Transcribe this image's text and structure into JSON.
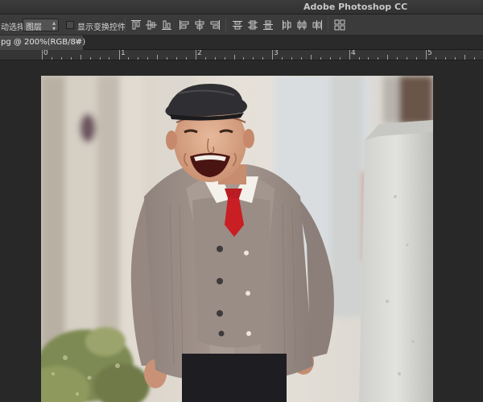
{
  "app": {
    "title": "Adobe Photoshop CC"
  },
  "options_bar": {
    "auto_select_label": "动选择:",
    "auto_select_value": "图层",
    "show_transform_label": "显示变换控件"
  },
  "document_tab": {
    "label": "pg @ 200%(RGB/8#)",
    "close": "×"
  },
  "ruler": {
    "labels": [
      "0",
      "1",
      "2",
      "3",
      "4",
      "5"
    ]
  },
  "icons": {
    "align": [
      "align-top-icon",
      "align-vcenter-icon",
      "align-bottom-icon",
      "align-left-icon",
      "align-hcenter-icon",
      "align-right-icon",
      "distribute-top-icon",
      "distribute-vcenter-icon",
      "distribute-bottom-icon",
      "distribute-left-icon",
      "distribute-hcenter-icon",
      "distribute-right-icon",
      "auto-align-icon"
    ]
  },
  "colors": {
    "ui_dark": "#282828",
    "panel": "#3b3b3b",
    "tie_red": "#c81e24",
    "cardigan": "#9c8e86"
  }
}
